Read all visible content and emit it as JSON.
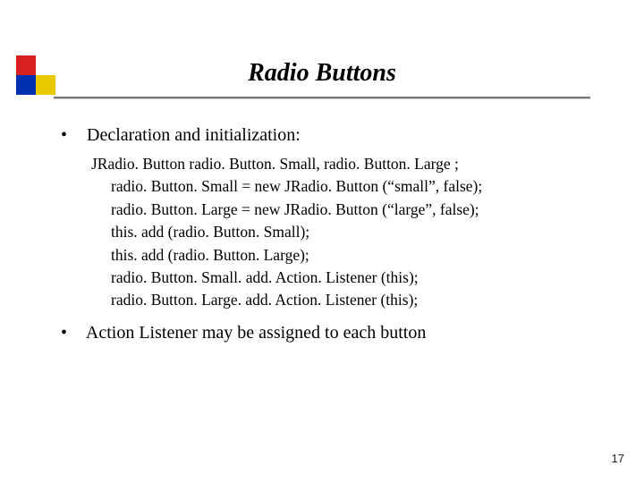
{
  "title": "Radio Buttons",
  "bullets": {
    "declaration": "Declaration and initialization:",
    "action_listener": "Action Listener may be assigned to each button"
  },
  "code": {
    "decl": "JRadio. Button radio. Button. Small, radio. Button. Large ;",
    "lines": [
      "radio. Button. Small = new JRadio. Button (“small”, false);",
      "radio. Button. Large = new JRadio. Button (“large”, false);",
      "this. add (radio. Button. Small);",
      "this. add (radio. Button. Large);",
      "radio. Button. Small. add. Action. Listener (this);",
      "radio. Button. Large. add. Action. Listener (this);"
    ]
  },
  "page_number": "17"
}
